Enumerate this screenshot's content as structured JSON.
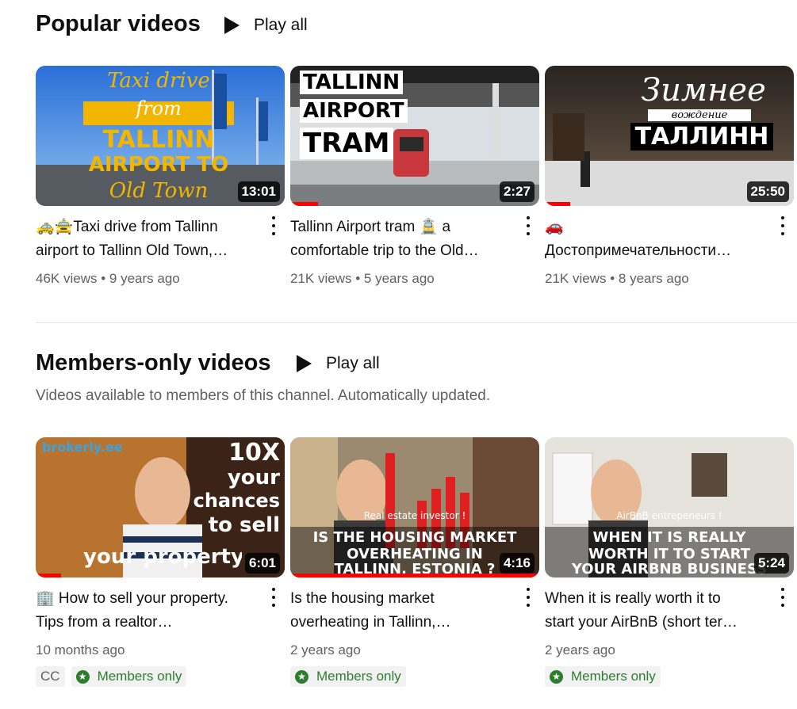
{
  "popular": {
    "title": "Popular videos",
    "play_all": "Play all",
    "videos": [
      {
        "title_line1": "🚕🚖Taxi drive from Tallinn",
        "title_line2": "airport to Tallinn Old Town,…",
        "views": "46K views",
        "age": "9 years ago",
        "duration": "13:01",
        "overlay": [
          "Taxi drive",
          "from",
          "TALLINN",
          "AIRPORT TO",
          "Old Town"
        ]
      },
      {
        "title_line1": "Tallinn Airport tram 🚊 a",
        "title_line2": "comfortable trip to the Old…",
        "views": "21K views",
        "age": "5 years ago",
        "duration": "2:27",
        "overlay": [
          "TALLINN",
          "AIRPORT",
          "TRAM"
        ]
      },
      {
        "title_line1": "🚗",
        "title_line2": "Достопримечательности…",
        "views": "21K views",
        "age": "8 years ago",
        "duration": "25:50",
        "overlay": [
          "Зимнее",
          "вождение",
          "ТАЛЛИНН"
        ]
      }
    ]
  },
  "members": {
    "title": "Members-only videos",
    "play_all": "Play all",
    "subtitle": "Videos available to members of this channel. Automatically updated.",
    "members_label": "Members only",
    "cc_label": "CC",
    "videos": [
      {
        "title_line1": "🏢 How to sell your property.",
        "title_line2": "Tips from a realtor…",
        "age": "10 months ago",
        "duration": "6:01",
        "overlay": [
          "brokerly.ee",
          "10X",
          "your",
          "chances",
          "to sell",
          "your property"
        ]
      },
      {
        "title_line1": "Is the housing market",
        "title_line2": "overheating in Tallinn,…",
        "age": "2 years ago",
        "duration": "4:16",
        "overlay": [
          "Real estate investor !",
          "IS THE HOUSING MARKET",
          "OVERHEATING IN",
          "TALLINN, ESTONIA ?"
        ]
      },
      {
        "title_line1": "When it is really worth it to",
        "title_line2": "start your AirBnB (short ter…",
        "age": "2 years ago",
        "duration": "5:24",
        "overlay": [
          "AirBnB entrepeneurs !",
          "WHEN IT IS REALLY",
          "WORTH IT TO START",
          "YOUR AIRBNB BUSINESS"
        ]
      }
    ]
  },
  "colors": {
    "red_progress": "#ff0000",
    "members_green": "#2d7d2e"
  }
}
